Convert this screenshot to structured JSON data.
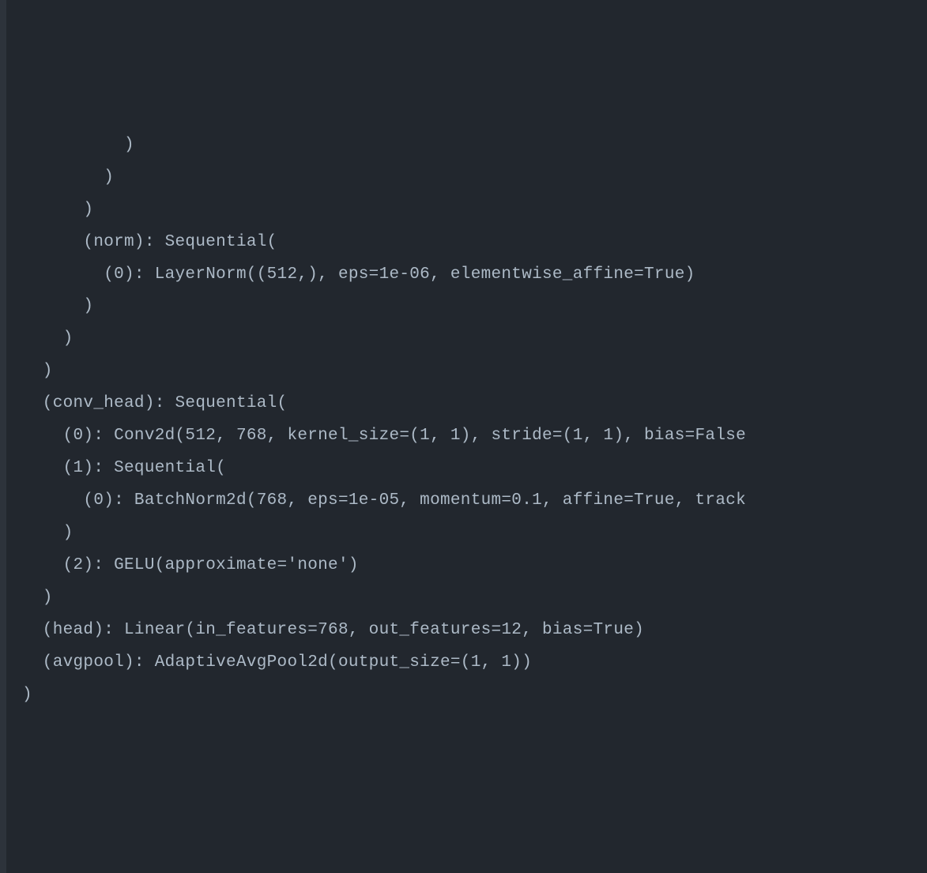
{
  "code": {
    "lines": [
      "          )",
      "        )",
      "      )",
      "      (norm): Sequential(",
      "        (0): LayerNorm((512,), eps=1e-06, elementwise_affine=True)",
      "      )",
      "    )",
      "  )",
      "  (conv_head): Sequential(",
      "    (0): Conv2d(512, 768, kernel_size=(1, 1), stride=(1, 1), bias=False",
      "    (1): Sequential(",
      "      (0): BatchNorm2d(768, eps=1e-05, momentum=0.1, affine=True, track",
      "    )",
      "    (2): GELU(approximate='none')",
      "  )",
      "  (head): Linear(in_features=768, out_features=12, bias=True)",
      "  (avgpool): AdaptiveAvgPool2d(output_size=(1, 1))",
      ")"
    ]
  }
}
